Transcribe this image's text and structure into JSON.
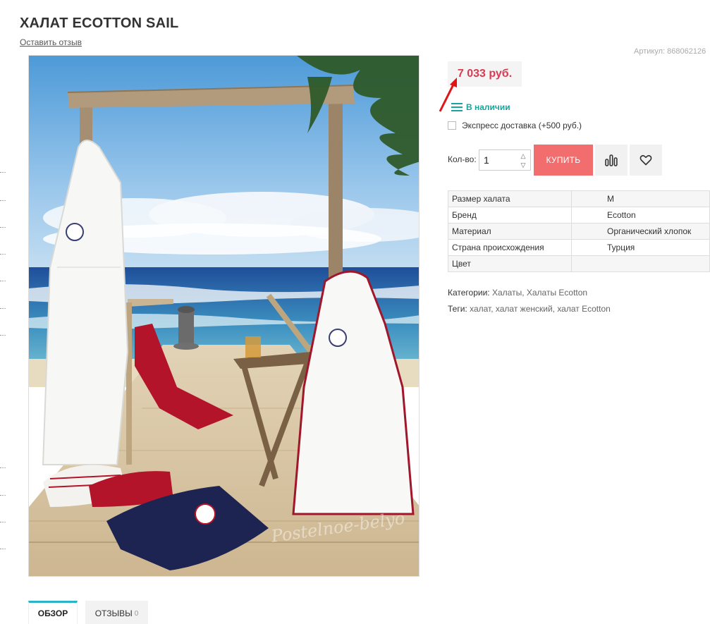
{
  "product": {
    "title": "ХАЛАТ ECOTTON SAIL",
    "review_link": "Оставить отзыв",
    "sku_label": "Артикул:",
    "sku_value": "868062126"
  },
  "image_watermark": "Postelnoe-belyo",
  "price": {
    "value": "7 033 руб.",
    "color": "#d83a50"
  },
  "stock": {
    "label": "В наличии",
    "color": "#1aa39a"
  },
  "express": {
    "label": "Экспресс доставка (+500 руб.)",
    "checked": false
  },
  "quantity": {
    "label": "Кол-во:",
    "value": "1"
  },
  "buttons": {
    "buy": "КУПИТЬ",
    "buy_color": "#f26d6d",
    "compare_icon": "compare-bars-icon",
    "wishlist_icon": "heart-icon"
  },
  "attributes": [
    {
      "name": "Размер халата",
      "value": "M"
    },
    {
      "name": "Бренд",
      "value": "Ecotton"
    },
    {
      "name": "Материал",
      "value": "Органический хлопок"
    },
    {
      "name": "Страна происхождения",
      "value": "Турция"
    },
    {
      "name": "Цвет",
      "value": ""
    }
  ],
  "categories": {
    "label": "Категории:",
    "value": "Халаты, Халаты Ecotton"
  },
  "tags": {
    "label": "Теги:",
    "value": "халат, халат женский, халат Ecotton"
  },
  "tabs": {
    "overview": "ОБЗОР",
    "reviews": "ОТЗЫВЫ",
    "reviews_count": "0",
    "accent_color": "#2bb4c8"
  }
}
